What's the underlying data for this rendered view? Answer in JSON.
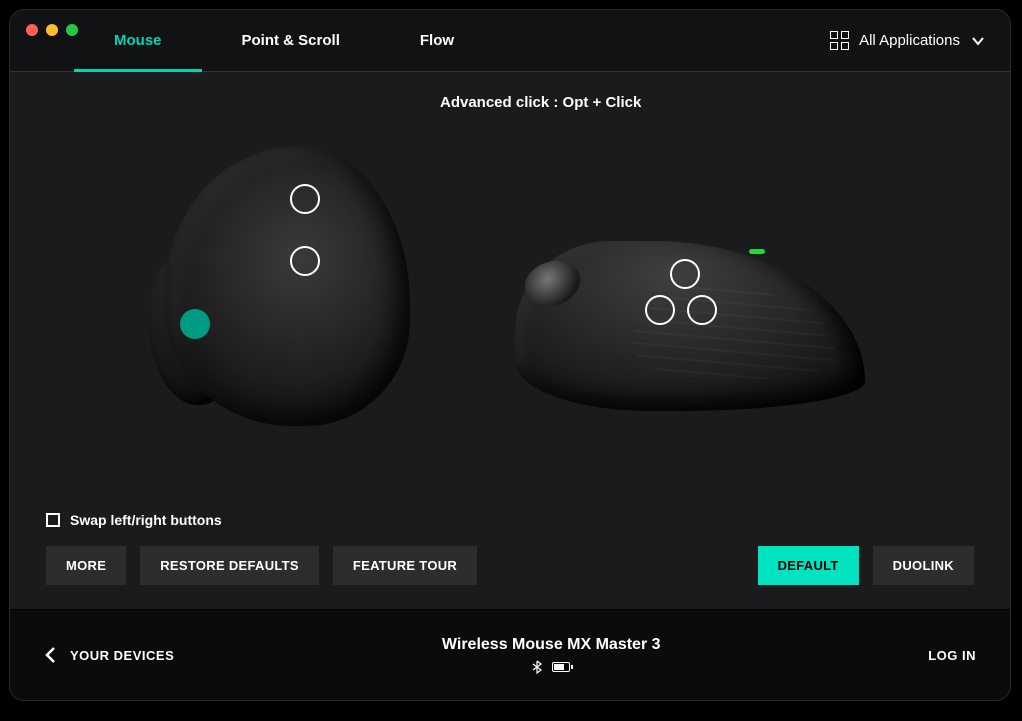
{
  "tabs": {
    "mouse": "Mouse",
    "pointScroll": "Point & Scroll",
    "flow": "Flow"
  },
  "appSelector": {
    "label": "All Applications"
  },
  "tooltip": "Advanced click : Opt + Click",
  "swap": {
    "label": "Swap left/right buttons",
    "checked": false
  },
  "buttons": {
    "more": "MORE",
    "restore": "RESTORE DEFAULTS",
    "tour": "FEATURE TOUR",
    "default": "DEFAULT",
    "duolink": "DUOLINK"
  },
  "footer": {
    "yourDevices": "YOUR DEVICES",
    "deviceName": "Wireless Mouse MX Master 3",
    "login": "LOG IN"
  },
  "brandColor": "#00d4b5"
}
